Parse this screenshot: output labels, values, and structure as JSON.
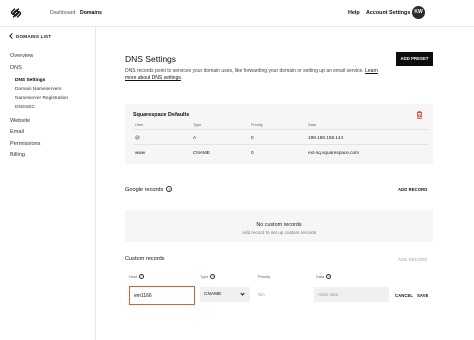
{
  "header": {
    "breadcrumbs": [
      "Dashboard",
      "Domains"
    ],
    "help_label": "Help",
    "account_label": "Account Settings",
    "avatar_initials": "KW"
  },
  "sidebar": {
    "back_label": "DOMAINS LIST",
    "items": [
      {
        "label": "Overview"
      },
      {
        "label": "DNS"
      },
      {
        "label": "Website"
      },
      {
        "label": "Email"
      },
      {
        "label": "Permissions"
      },
      {
        "label": "Billing"
      }
    ],
    "dns_sub_items": [
      {
        "label": "DNS Settings",
        "active": true
      },
      {
        "label": "Domain Nameservers",
        "active": false
      },
      {
        "label": "Nameserver Registration",
        "active": false
      },
      {
        "label": "DNSSEC",
        "active": false
      }
    ]
  },
  "main": {
    "title": "DNS Settings",
    "description": "DNS records point to services your domain uses, like forwarding your domain or setting up an email service.",
    "learn_more": "Learn more about DNS settings",
    "add_preset_label": "ADD PRESET",
    "squarespace_defaults": {
      "title": "Squarespace Defaults",
      "columns": [
        "Host",
        "Type",
        "Priority",
        "Data"
      ],
      "rows": [
        {
          "host": "@",
          "type": "A",
          "priority": "0",
          "data": "198.185.159.144"
        },
        {
          "host": "www",
          "type": "CNAME",
          "priority": "0",
          "data": "ext-sq.squarespace.com"
        }
      ]
    },
    "google_records": {
      "title": "Google records",
      "help": "?",
      "add_label": "ADD RECORD",
      "empty_title": "No custom records",
      "empty_subtitle": "Add record to set up custom records"
    },
    "custom_records": {
      "title": "Custom records",
      "add_label": "ADD RECORD",
      "fields": {
        "host_label": "Host",
        "type_label": "Type",
        "priority_label": "Priority",
        "data_label": "Data",
        "help": "?",
        "host_value": "em1166",
        "type_value": "CNAME",
        "priority_placeholder": "N/A",
        "data_placeholder": "Alias data"
      },
      "cancel_label": "CANCEL",
      "save_label": "SAVE"
    }
  },
  "colors": {
    "primary_button": "#0d0d0d",
    "focus_border": "#e05a3c",
    "trash_icon": "#d9342b",
    "card_background": "#f6f6f6"
  }
}
